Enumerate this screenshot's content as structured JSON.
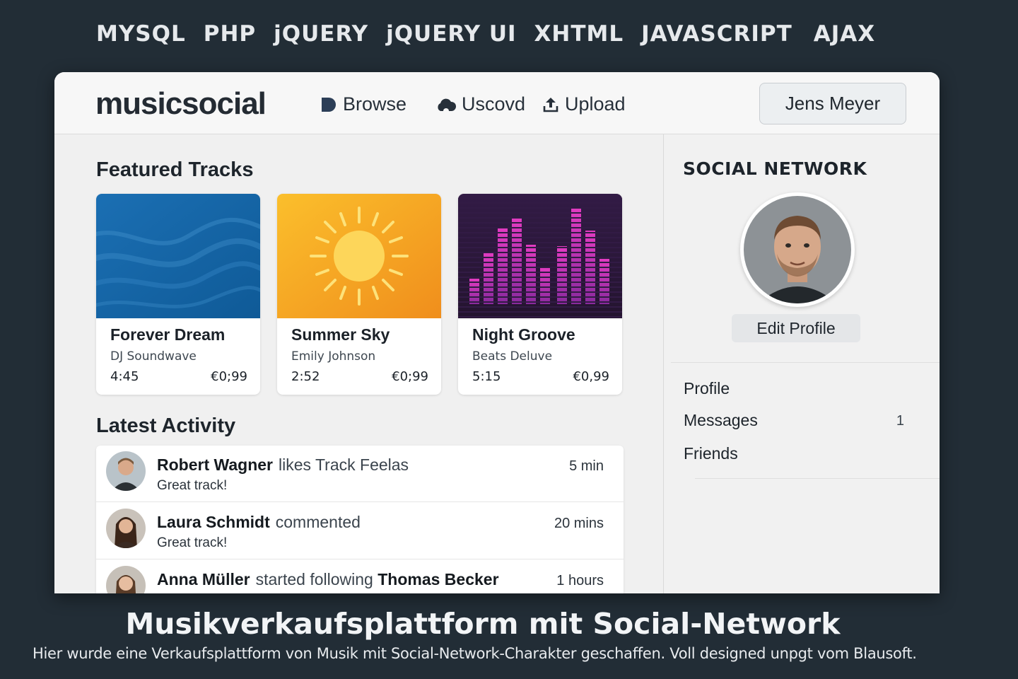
{
  "tech_stack": [
    "MYSQL",
    "PHP",
    "jQUERY",
    "jQUERY UI",
    "XHTML",
    "JAVASCRIPT",
    "AJAX"
  ],
  "app": {
    "logo": "musicsocial",
    "nav": {
      "browse": {
        "label": "Browse",
        "icon": "play-icon"
      },
      "discover": {
        "label": "Uscovd",
        "icon": "cloud-icon"
      },
      "upload": {
        "label": "Upload",
        "icon": "upload-icon"
      }
    },
    "user_name": "Jens Meyer"
  },
  "featured": {
    "title": "Featured Tracks",
    "tracks": [
      {
        "title": "Forever Dream",
        "artist": "DJ Soundwave",
        "duration": "4:45",
        "price": "€0;99",
        "art": "blue-waves",
        "accent": "#1f6fae"
      },
      {
        "title": "Summer Sky",
        "artist": "Emily Johnson",
        "duration": "2:52",
        "price": "€0;99",
        "art": "sun",
        "accent": "#f6a524"
      },
      {
        "title": "Night Groove",
        "artist": "Beats Deluve",
        "duration": "5:15",
        "price": "€0,99",
        "art": "equalizer",
        "accent": "#c02aa6"
      }
    ]
  },
  "activity": {
    "title": "Latest Activity",
    "items": [
      {
        "user": "Robert Wagner",
        "action": "likes Track Feelas",
        "target": "",
        "comment": "Great track!",
        "time": "5 min"
      },
      {
        "user": "Laura Schmidt",
        "action": "commented",
        "target": "",
        "comment": "Great track!",
        "time": "20 mins"
      },
      {
        "user": "Anna Müller",
        "action": "started following",
        "target": "Thomas Becker",
        "comment": "",
        "time": "1 hours"
      }
    ]
  },
  "social": {
    "title": "SOCIAL NETWORK",
    "edit_profile": "Edit Profile",
    "menu": {
      "profile": "Profile",
      "messages": "Messages",
      "messages_count": "1",
      "friends": "Friends"
    }
  },
  "caption": {
    "title": "Musikverkaufsplattform mit Social-Network",
    "subtitle": "Hier wurde eine Verkaufsplattform von Musik mit Social-Network-Charakter geschaffen. Voll designed unpgt vom Blausoft."
  }
}
